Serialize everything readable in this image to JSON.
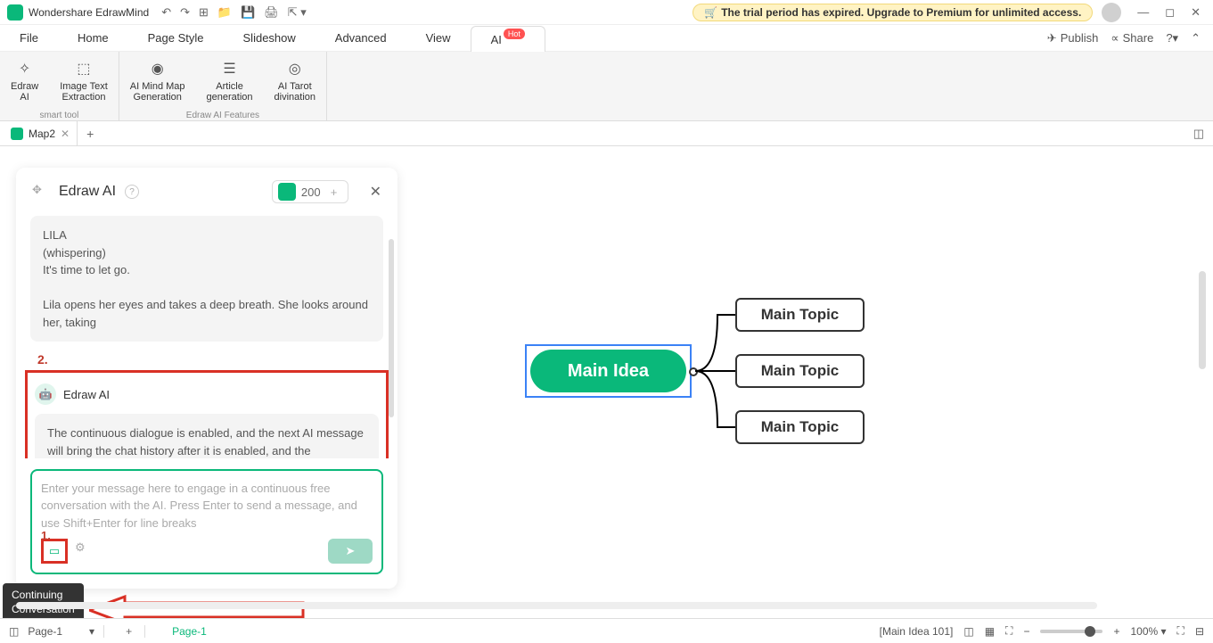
{
  "app": {
    "title": "Wondershare EdrawMind"
  },
  "trial": {
    "text": "The trial period has expired. Upgrade to Premium for unlimited access."
  },
  "menu": {
    "items": [
      "File",
      "Home",
      "Page Style",
      "Slideshow",
      "Advanced",
      "View",
      "AI"
    ],
    "hot": "Hot",
    "publish": "Publish",
    "share": "Share"
  },
  "ribbon": {
    "items": [
      {
        "label": "Edraw\nAI"
      },
      {
        "label": "Image Text\nExtraction"
      },
      {
        "label": "AI Mind Map\nGeneration"
      },
      {
        "label": "Article\ngeneration"
      },
      {
        "label": "AI Tarot\ndivination"
      }
    ],
    "group1": "smart tool",
    "group2": "Edraw AI Features"
  },
  "tabs": {
    "doc": "Map2"
  },
  "ai_panel": {
    "title": "Edraw AI",
    "tokens": "200",
    "msg1_lines": [
      "LILA",
      "(whispering)",
      "It's time to let go.",
      "",
      "Lila opens her eyes and takes a deep breath. She looks around her, taking"
    ],
    "callout2": "2.",
    "sender": "Edraw AI",
    "msg2": "The continuous dialogue is enabled, and the next AI message will bring the chat history after it is enabled, and the consumption of EdrawMind AI tokens will be accelerated.",
    "placeholder": "Enter your message here to engage in a continuous free conversation with the AI. Press Enter to send a message, and use Shift+Enter for line breaks",
    "callout1": "1.",
    "tooltip": "Continuing\nConversation"
  },
  "mindmap": {
    "main": "Main Idea",
    "topics": [
      "Main Topic",
      "Main Topic",
      "Main Topic"
    ]
  },
  "status": {
    "page_label": "Page-1",
    "page_active": "Page-1",
    "node_info": "[Main Idea 101]",
    "zoom": "100%"
  }
}
